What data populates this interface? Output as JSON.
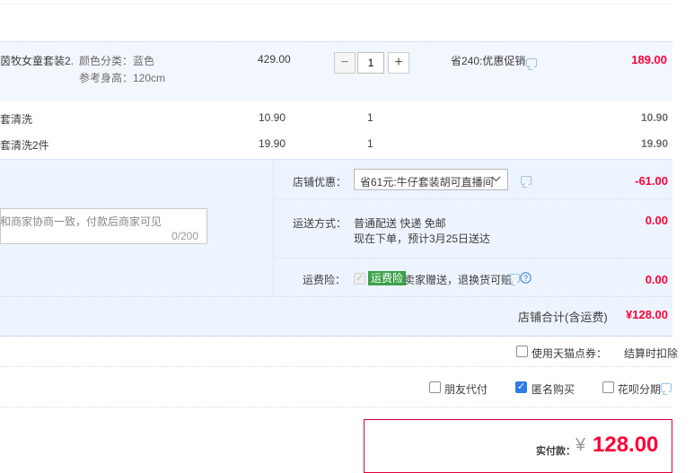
{
  "items": [
    {
      "name": "茵牧女童套装2...",
      "attr1": "颜色分类：蓝色",
      "attr2": "参考身高：120cm",
      "unit_price": "429.00",
      "qty": "1",
      "promo": "省240:优惠促销",
      "subtotal": "189.00"
    },
    {
      "name": "套清洗",
      "unit_price": "10.90",
      "qty": "1",
      "subtotal": "10.90"
    },
    {
      "name": "套清洗2件",
      "unit_price": "19.90",
      "qty": "1",
      "subtotal": "19.90"
    }
  ],
  "stepper": {
    "minus": "−",
    "plus": "+"
  },
  "shop": {
    "discount_label": "店铺优惠：",
    "discount_selected": "省61元:牛仔套装胡可直播间",
    "discount_amount": "-61.00",
    "shipping_label": "运送方式：",
    "shipping_method": "普通配送 快递 免邮",
    "shipping_eta": "现在下单，预计3月25日送达",
    "shipping_amount": "0.00",
    "insurance_label": "运费险：",
    "insurance_badge": "运费险",
    "insurance_text": "卖家赠送，退换货可赔",
    "insurance_amount": "0.00",
    "total_label": "店铺合计(含运费)",
    "total_amount": "¥128.00"
  },
  "memo": {
    "placeholder": "和商家协商一致，付款后商家可见",
    "counter": "0/200"
  },
  "options": {
    "tmall_points": "使用天猫点券：",
    "checkout_deduct": "结算时扣除",
    "friend_pay": "朋友代付",
    "anonymous": "匿名购买",
    "huabei": "花呗分期"
  },
  "pay": {
    "label": "实付款：",
    "currency": "¥",
    "amount": "128.00"
  },
  "colors": {
    "accent_red": "#ff0036",
    "checkbox_blue": "#2d7be5",
    "badge_green": "#3aa14a"
  }
}
